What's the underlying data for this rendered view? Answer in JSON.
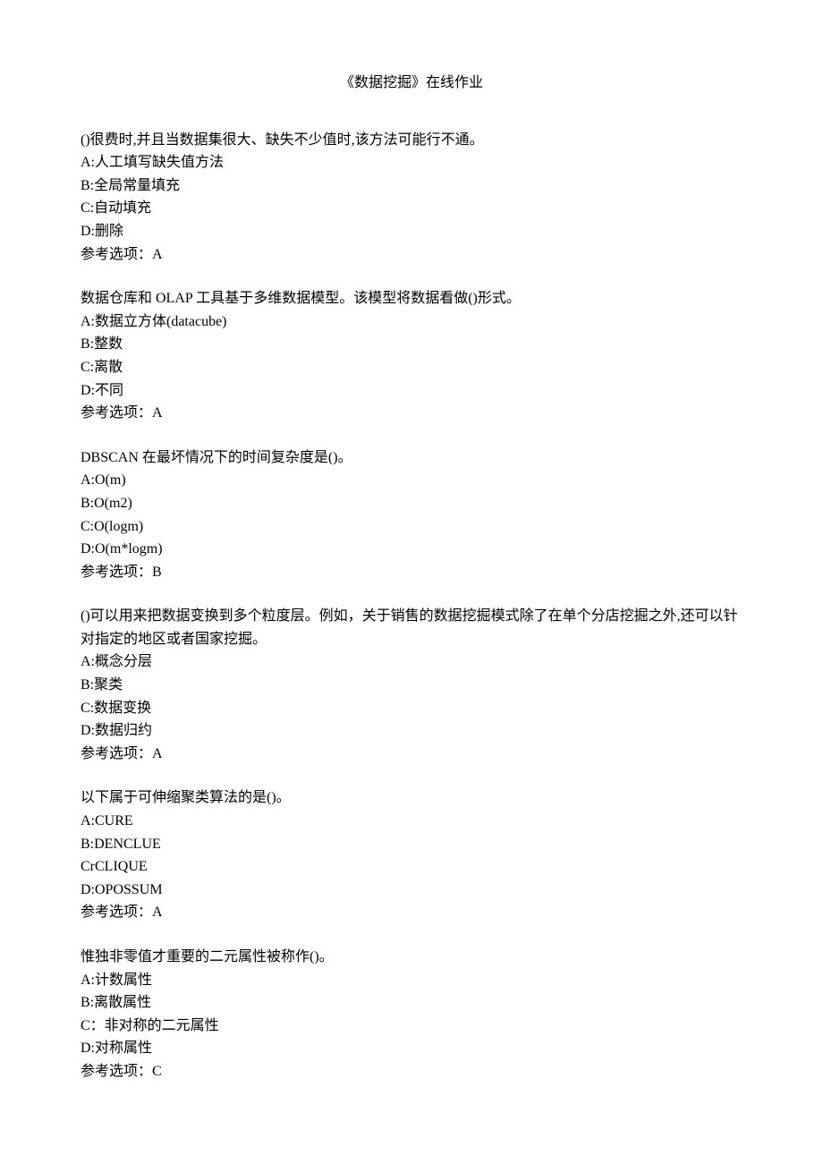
{
  "title": "《数据挖掘》在线作业",
  "questions": [
    {
      "stem": "()很费时,并且当数据集很大、缺失不少值时,该方法可能行不通。",
      "options": [
        "A:人工填写缺失值方法",
        "B:全局常量填充",
        "C:自动填充",
        "D:删除"
      ],
      "answer": "参考选项：A"
    },
    {
      "stem": "数据仓库和 OLAP 工具基于多维数据模型。该模型将数据看做()形式。",
      "options": [
        "A:数据立方体(datacube)",
        "B:整数",
        "C:离散",
        "D:不同"
      ],
      "answer": "参考选项：A"
    },
    {
      "stem": "DBSCAN 在最坏情况下的时间复杂度是()。",
      "options": [
        "A:O(m)",
        "B:O(m2)",
        "C:O(logm)",
        "D:O(m*logm)"
      ],
      "answer": "参考选项：B"
    },
    {
      "stem": "()可以用来把数据变换到多个粒度层。例如，关于销售的数据挖掘模式除了在单个分店挖掘之外,还可以针对指定的地区或者国家挖掘。",
      "options": [
        "A:概念分层",
        "B:聚类",
        "C:数据变换",
        "D:数据归约"
      ],
      "answer": "参考选项：A"
    },
    {
      "stem": "以下属于可伸缩聚类算法的是()。",
      "options": [
        "A:CURE",
        "B:DENCLUE",
        "CrCLIQUE",
        "D:OPOSSUM"
      ],
      "answer": "参考选项：A"
    },
    {
      "stem": "惟独非零值才重要的二元属性被称作()。",
      "options": [
        "A:计数属性",
        "B:离散属性",
        "C：非对称的二元属性",
        "D:对称属性"
      ],
      "answer": "参考选项：C"
    }
  ]
}
